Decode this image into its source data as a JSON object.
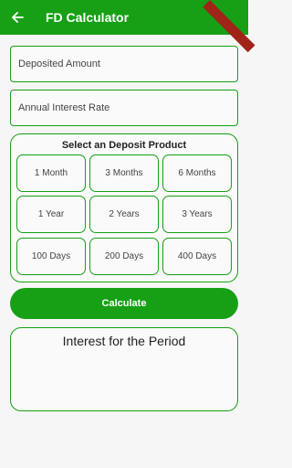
{
  "appbar": {
    "title": "FD Calculator",
    "back_icon": "arrow-left-icon",
    "color": "#17a016"
  },
  "inputs": {
    "deposited_amount_placeholder": "Deposited Amount",
    "interest_rate_placeholder": "Annual Interest Rate"
  },
  "deposit_product": {
    "title": "Select an Deposit Product",
    "options": [
      "1 Month",
      "3 Months",
      "6 Months",
      "1 Year",
      "2 Years",
      "3 Years",
      "100 Days",
      "200 Days",
      "400 Days"
    ]
  },
  "actions": {
    "calculate_label": "Calculate"
  },
  "result": {
    "title": "Interest for the Period"
  }
}
